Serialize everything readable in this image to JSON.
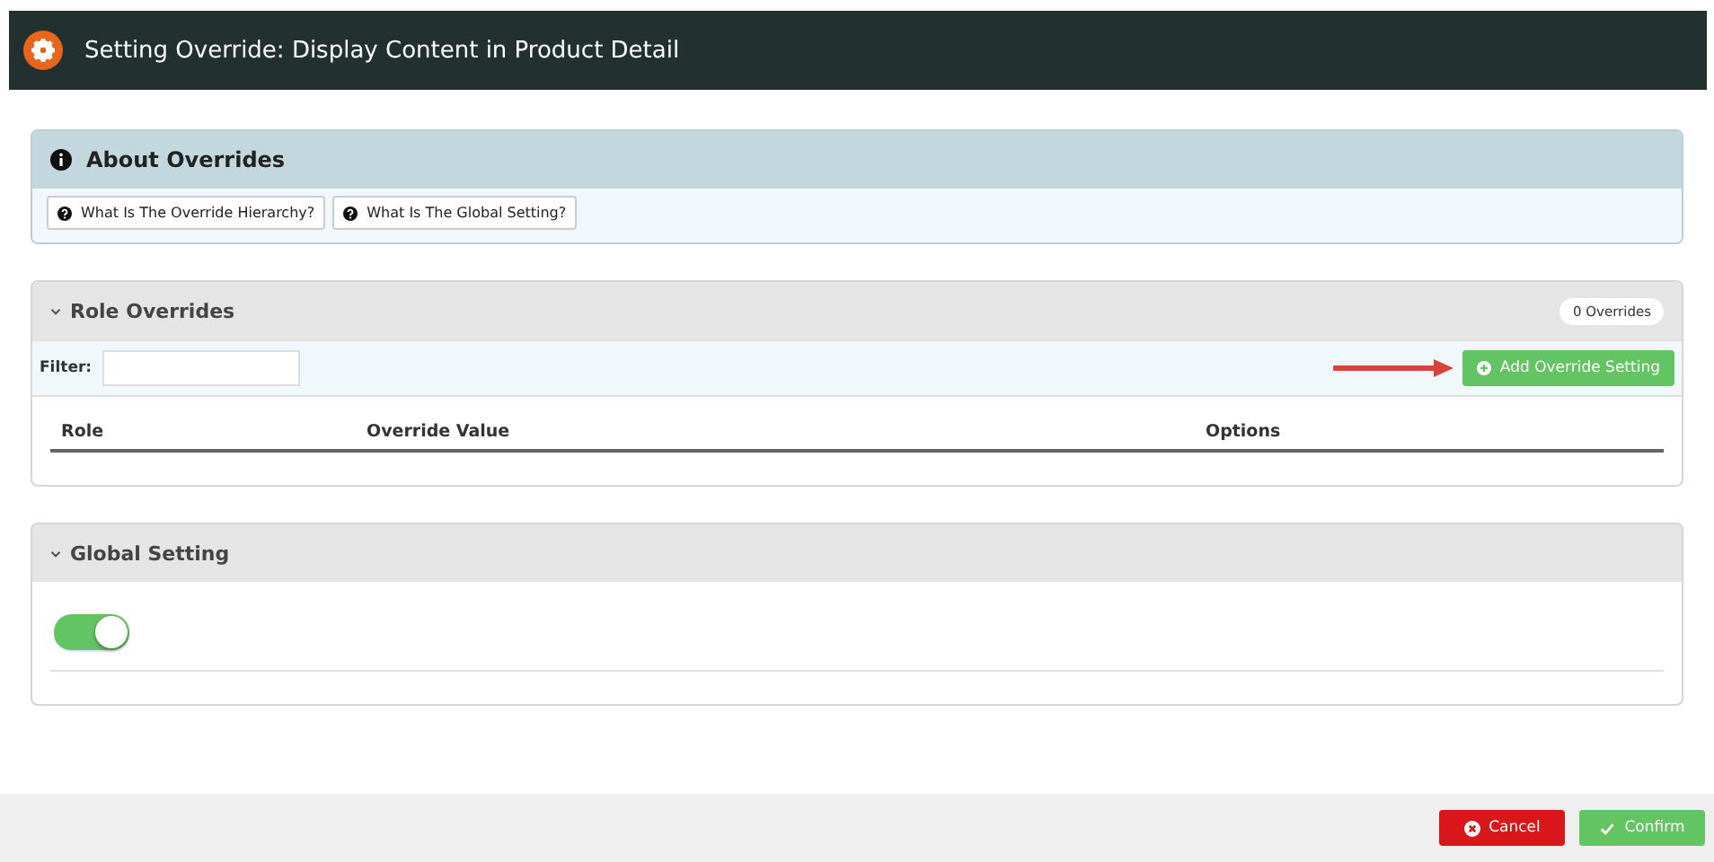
{
  "window": {
    "title": "Setting Override: Display Content in Product Detail"
  },
  "about": {
    "title": "About Overrides",
    "buttons": [
      "What Is The Override Hierarchy?",
      "What Is The Global Setting?"
    ]
  },
  "role_overrides": {
    "title": "Role Overrides",
    "expanded": true,
    "count": "0 Overrides",
    "filter_label": "Filter:",
    "add_button": "Add Override Setting",
    "columns": [
      "Role",
      "Override Value",
      "Options"
    ]
  },
  "global_setting": {
    "title": "Global Setting",
    "expanded": true,
    "on": true
  },
  "footer": {
    "buttons": [
      {
        "kind": "cancel",
        "label": "Cancel"
      },
      {
        "kind": "confirm",
        "label": "Confirm"
      }
    ]
  }
}
